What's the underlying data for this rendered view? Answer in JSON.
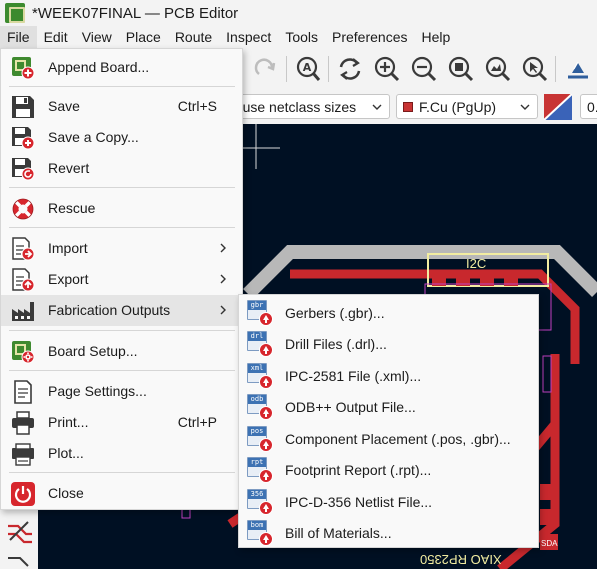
{
  "window": {
    "title": "*WEEK07FINAL — PCB Editor"
  },
  "menubar": {
    "items": [
      "File",
      "Edit",
      "View",
      "Place",
      "Route",
      "Inspect",
      "Tools",
      "Preferences",
      "Help"
    ]
  },
  "toolbar2": {
    "track_width": "a: use netclass sizes",
    "layer": "F.Cu (PgUp)",
    "grid_partial": "0."
  },
  "canvas": {
    "ref_i2c": "I2C",
    "mirrored_text": "XIAO RP2350",
    "pad_label": "SDA"
  },
  "file_menu": {
    "items": [
      {
        "label": "Append Board...",
        "icon": "append-board-icon"
      },
      {
        "label": "Save",
        "shortcut": "Ctrl+S",
        "icon": "save-icon"
      },
      {
        "label": "Save a Copy...",
        "icon": "save-copy-icon"
      },
      {
        "label": "Revert",
        "icon": "revert-icon"
      },
      {
        "label": "Rescue",
        "icon": "rescue-icon"
      },
      {
        "label": "Import",
        "icon": "import-icon",
        "submenu": true
      },
      {
        "label": "Export",
        "icon": "export-icon",
        "submenu": true
      },
      {
        "label": "Fabrication Outputs",
        "icon": "fabrication-icon",
        "submenu": true,
        "highlighted": true
      },
      {
        "label": "Board Setup...",
        "icon": "board-setup-icon"
      },
      {
        "label": "Page Settings...",
        "icon": "page-settings-icon"
      },
      {
        "label": "Print...",
        "shortcut": "Ctrl+P",
        "icon": "print-icon"
      },
      {
        "label": "Plot...",
        "icon": "plot-icon"
      },
      {
        "label": "Close",
        "icon": "close-icon"
      }
    ]
  },
  "fab_submenu": {
    "items": [
      {
        "label": "Gerbers (.gbr)...",
        "tag": "gbr"
      },
      {
        "label": "Drill Files (.drl)...",
        "tag": "drl"
      },
      {
        "label": "IPC-2581 File (.xml)...",
        "tag": "xml"
      },
      {
        "label": "ODB++ Output File...",
        "tag": "odb"
      },
      {
        "label": "Component Placement (.pos, .gbr)...",
        "tag": "pos"
      },
      {
        "label": "Footprint Report (.rpt)...",
        "tag": "rpt"
      },
      {
        "label": "IPC-D-356 Netlist File...",
        "tag": "356"
      },
      {
        "label": "Bill of Materials...",
        "tag": "bom"
      }
    ]
  },
  "colors": {
    "canvas_bg": "#001023",
    "track_red": "#c8282d",
    "board_edge": "#c8c8c8",
    "silkscreen": "#f2eda1"
  }
}
